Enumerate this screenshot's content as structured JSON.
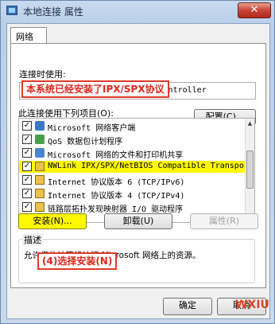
{
  "window": {
    "title": "本地连接 属性",
    "close_glyph": "✕"
  },
  "tabs": [
    {
      "label": "网络"
    }
  ],
  "connect_using": {
    "label": "连接时使用:",
    "adapter": "NVIDIA nForce Networking Controller",
    "configure_button": "配置(C)..."
  },
  "items_section": {
    "label": "此连接使用下列项目(O):",
    "items": [
      {
        "text": "Microsoft 网络客户端",
        "checked": true,
        "icon": "client-icon"
      },
      {
        "text": "QoS 数据包计划程序",
        "checked": true,
        "icon": "qos-icon"
      },
      {
        "text": "Microsoft 网络的文件和打印机共享",
        "checked": true,
        "icon": "share-icon"
      },
      {
        "text": "NWLink IPX/SPX/NetBIOS Compatible Transpor…",
        "checked": true,
        "icon": "protocol-icon",
        "selected": true
      },
      {
        "text": "Internet 协议版本 6 (TCP/IPv6)",
        "checked": true,
        "icon": "protocol-icon"
      },
      {
        "text": "Internet 协议版本 4 (TCP/IPv4)",
        "checked": true,
        "icon": "protocol-icon"
      },
      {
        "text": "链路层拓扑发现映射器 I/O 驱动程序",
        "checked": true,
        "icon": "protocol-icon"
      }
    ]
  },
  "buttons": {
    "install": "安装(N)...",
    "uninstall": "卸载(U)",
    "properties": "属性(R)",
    "ok": "确定",
    "cancel": "取消"
  },
  "description": {
    "label": "描述",
    "text": "允许您的计算机访问 Microsoft 网络上的资源。"
  },
  "annotations": {
    "top": "本系统已经安装了IPX/SPX协议",
    "bottom": "(4)选择安装(N)",
    "color": "#e23a2a"
  },
  "watermark": "WXIU"
}
